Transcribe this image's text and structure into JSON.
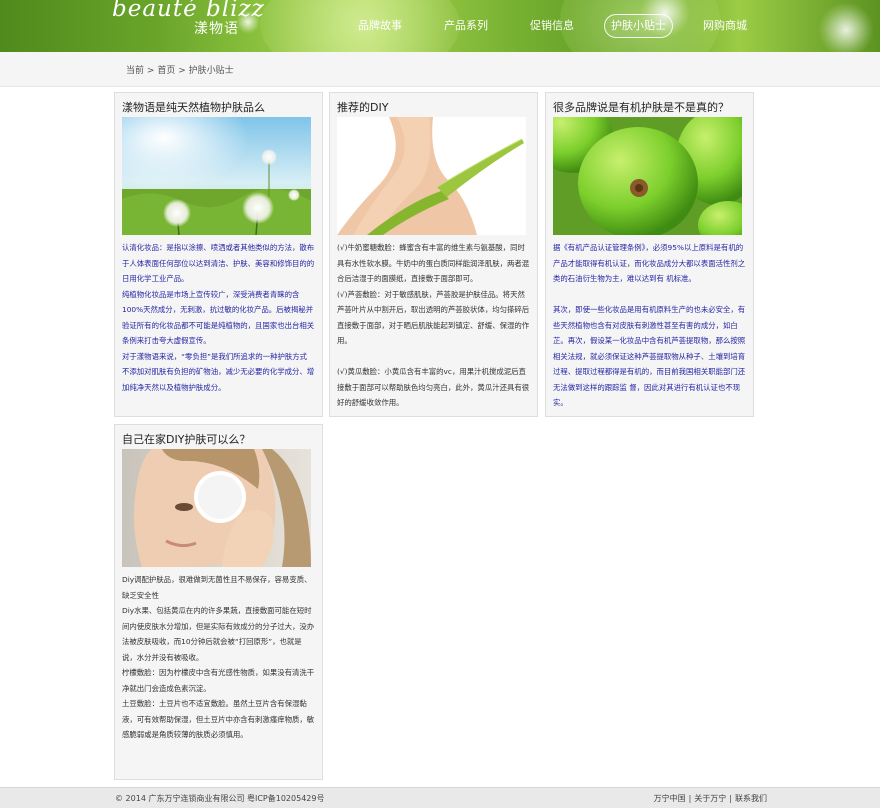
{
  "header": {
    "logo_latin": "beauté blizz",
    "logo_cn": "漾物语",
    "nav": [
      {
        "label": "品牌故事"
      },
      {
        "label": "产品系列"
      },
      {
        "label": "促销信息"
      },
      {
        "label": "护肤小贴士",
        "active": true
      },
      {
        "label": "网购商城"
      }
    ]
  },
  "breadcrumb": {
    "current_prefix": "当前",
    "sep": ">",
    "home": "首页",
    "page": "护肤小贴士"
  },
  "articles": [
    {
      "title": "漾物语是纯天然植物护肤品么",
      "image": "dandelion-field-photo",
      "paragraphs": [
        {
          "text": "认清化妆品：是指以涂擦、喷洒或者其他类似的方法，散布于人体表面任何部位以达到清洁、护肤、美容和修饰目的的日用化学工业产品。",
          "color": "blue"
        },
        {
          "text": "纯植物化妆品是市场上宣传较广，深受消费者青睐的含100%天然成分，无刺激，抗过敏的化妆产品。后被揭秘并验证所有的化妆品都不可能是纯植物的，且国家也出台相关条例来打击夸大虚假宣传。",
          "color": "blue"
        },
        {
          "text": "对于漾物语来说，“零负担”是我们所追求的一种护肤方式",
          "color": "blue"
        },
        {
          "text": "不添加对肌肤有负担的矿物油，减少无必要的化学成分、增加纯净天然以及植物护肤成分。",
          "color": "blue"
        }
      ]
    },
    {
      "title": "推荐的DIY",
      "image": "woman-shoulder-leaf-photo",
      "paragraphs": [
        {
          "text": "(√)牛奶蜜糖敷脸：蜂蜜含有丰富的维生素与氨基酸，同时具有水性软水膜。牛奶中的蛋白质同样能润泽肌肤，两者混合后洁湿于的面膜纸，直接敷于面部即可。",
          "color": "dark"
        },
        {
          "text": "(√)芦荟敷脸：对于敏感肌肤，芦荟胶是护肤佳品。将天然芦荟叶片从中割开后，取出透明的芦荟胶状体，均匀搽碎后直接敷于面部，对于晒后肌肤能起到镇定、舒缓、保湿的作用。",
          "color": "dark"
        },
        {
          "text": "",
          "color": "dark"
        },
        {
          "text": "(√)黄瓜敷脸：小黄瓜含有丰富的vc，用果汁机搅成泥后直接敷于面部可以帮助肤色均匀亮白，此外，黄瓜汁还具有很好的舒缓收敛作用。",
          "color": "dark"
        }
      ]
    },
    {
      "title": "很多品牌说是有机护肤是不是真的？",
      "image": "green-fruit-photo",
      "paragraphs": [
        {
          "text": "据《有机产品认证管理条例》，必须95%以上原料是有机的产品才能取得有机认证，而化妆品成分大都以表面活性剂之类的石油衍生物为主，难以达到有 机标准。",
          "color": "blue"
        },
        {
          "text": "",
          "color": "blue"
        },
        {
          "text": "其次，即使一些化妆品是用有机原料生产的也未必安全，有些天然植物也含有对皮肤有刺激性甚至有害的成分，如白芷。再次，假设某一化妆品中含有机芦荟提取物，那么按照相关法规，就必须保证这种芦荟提取物从种子、土壤到培育过程、提取过程都得是有机的，而目前我国相关职能部门还无法做到这样的跟踪监 督，因此对其进行有机认证也不现实。",
          "color": "blue"
        }
      ]
    },
    {
      "title": "自己在家DIY护肤可以么？",
      "image": "woman-cotton-pad-photo",
      "paragraphs": [
        {
          "text": "Diy调配护肤品，很难做到无菌性且不易保存，容易变质、缺乏安全性",
          "color": "dark"
        },
        {
          "text": "Diy水果、包括黄瓜在内的许多果蔬，直接敷面可能在短时间内使皮肤水分增加，但是实际有效成分的分子过大，没办法被皮肤吸收，而10分钟后就会被“打回原形”，也就是说，水分并没有被吸收。",
          "color": "dark"
        },
        {
          "text": "柠檬敷脸：因为柠檬皮中含有光感性物质，如果没有清洗干净就出门会造成色素沉淀。",
          "color": "dark"
        },
        {
          "text": "土豆敷脸：土豆片也不适宜敷脸。虽然土豆片含有保湿黏液，可有效帮助保湿，但土豆片中亦含有刺激瘙痒物质，敏感脆弱或是角质较薄的肤质必须慎用。",
          "color": "dark"
        }
      ]
    }
  ],
  "footer": {
    "copyright": "© 2014 广东万宁连锁商业有限公司 粤ICP备10205429号",
    "links": [
      "万宁中国",
      "关于万宁",
      "联系我们"
    ],
    "sep": "|"
  },
  "colors": {
    "header_green": "#6aa52a",
    "link_blue": "#2424a6",
    "card_bg": "#f5f5f5",
    "footer_bg": "#e9e9e9"
  }
}
